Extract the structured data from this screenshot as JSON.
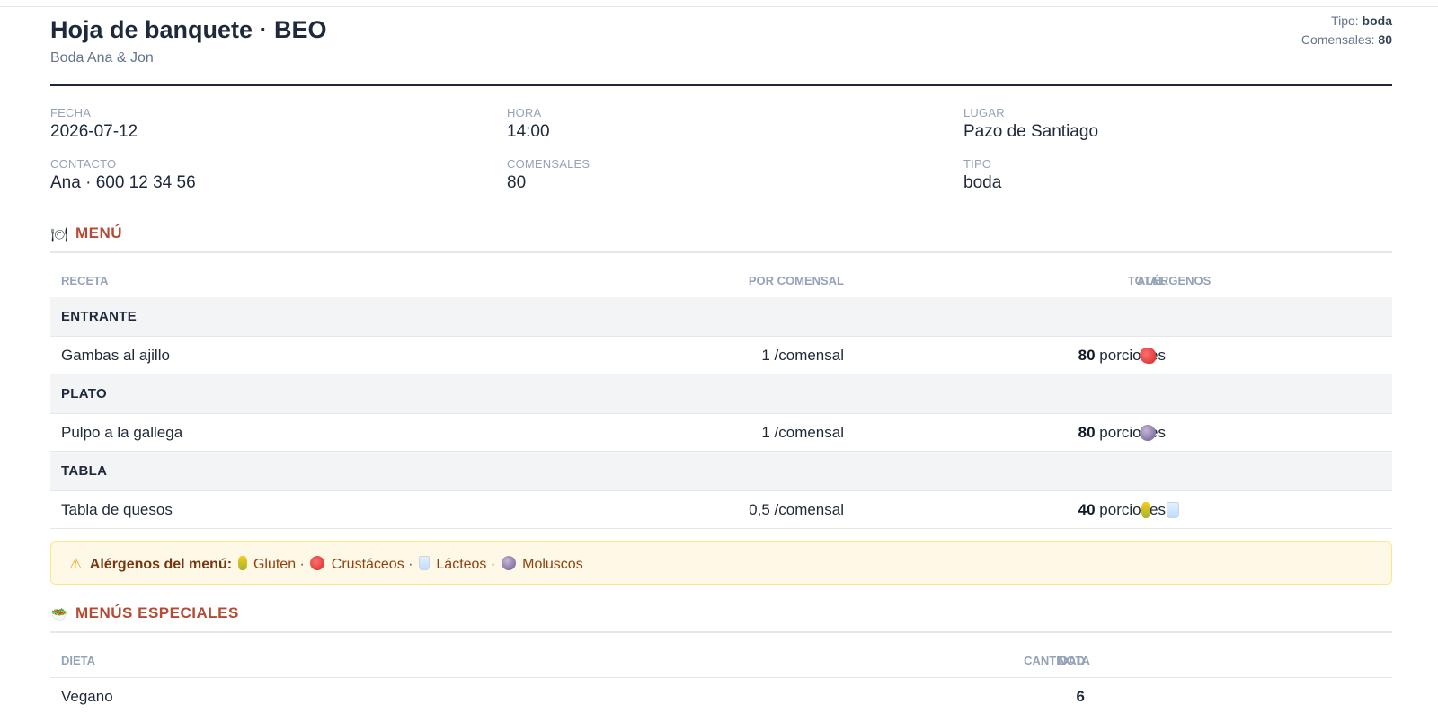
{
  "header": {
    "title": "Hoja de banquete · BEO",
    "subtitle": "Boda Ana & Jon",
    "tipo_label": "Tipo:",
    "tipo_value": "boda",
    "comensales_label": "Comensales:",
    "comensales_value": "80"
  },
  "info": [
    {
      "label": "FECHA",
      "value": "2026-07-12"
    },
    {
      "label": "HORA",
      "value": "14:00"
    },
    {
      "label": "LUGAR",
      "value": "Pazo de Santiago"
    },
    {
      "label": "CONTACTO",
      "value": "Ana · 600 12 34 56"
    },
    {
      "label": "COMENSALES",
      "value": "80"
    },
    {
      "label": "TIPO",
      "value": "boda"
    }
  ],
  "menu": {
    "title": "MENÚ",
    "icon": "plate-icon",
    "headers": {
      "receta": "RECETA",
      "por_comensal": "POR COMENSAL",
      "total": "TOTAL",
      "alergenos": "ALÉRGENOS"
    },
    "unit_per": "/comensal",
    "unit_total": "porciones",
    "categories": [
      {
        "name": "ENTRANTE",
        "recipe": "Gambas al ajillo",
        "per": "1",
        "total": "80",
        "allergens": [
          "shrimp-icon"
        ]
      },
      {
        "name": "PLATO",
        "recipe": "Pulpo a la gallega",
        "per": "1",
        "total": "80",
        "allergens": [
          "octopus-icon"
        ]
      },
      {
        "name": "TABLA",
        "recipe": "Tabla de quesos",
        "per": "0,5",
        "total": "40",
        "allergens": [
          "wheat-icon",
          "milk-icon"
        ]
      }
    ]
  },
  "allergen_note": {
    "label": "Alérgenos del menú:",
    "items": [
      "Gluten",
      "Crustáceos",
      "Lácteos",
      "Moluscos"
    ],
    "separator": "·"
  },
  "special": {
    "title": "MENÚS ESPECIALES",
    "icon": "salad-icon",
    "headers": {
      "dieta": "DIETA",
      "cantidad": "CANTIDAD",
      "nota": "NOTA"
    },
    "rows": [
      {
        "dieta": "Vegano",
        "cantidad": "6",
        "nota": ""
      }
    ]
  },
  "colors": {
    "accent": "#b54b33",
    "dark": "#1e293b",
    "muted": "#94a3b8",
    "warn_bg": "#fef9e7"
  }
}
